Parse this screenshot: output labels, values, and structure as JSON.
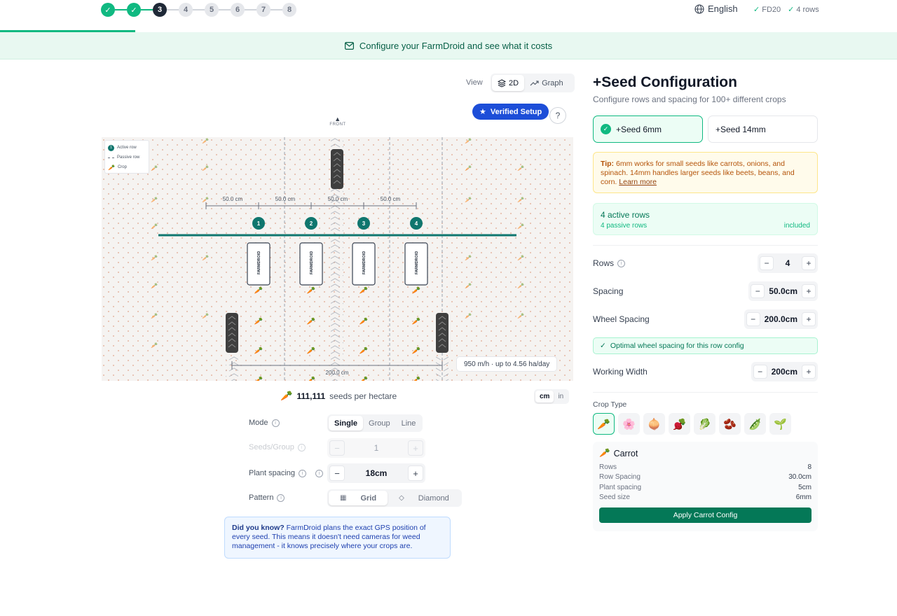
{
  "stepper": {
    "steps": [
      "1",
      "2",
      "3",
      "4",
      "5",
      "6",
      "7",
      "8"
    ],
    "completed": 2,
    "current": 3
  },
  "header": {
    "language": "English",
    "model_tags": [
      "FD20",
      "4 rows"
    ]
  },
  "banner": {
    "text": "Configure your FarmDroid and see what it costs"
  },
  "view": {
    "label": "View",
    "options": [
      "2D",
      "Graph"
    ],
    "selected": "2D"
  },
  "verified_label": "Verified Setup",
  "help_symbol": "?",
  "field": {
    "front_label": "FRONT",
    "legend": {
      "active_row": "Active row",
      "passive_row": "Passive row",
      "crop": "Crop",
      "marker": "1"
    },
    "row_spacing_labels": [
      "50.0 cm",
      "50.0 cm",
      "50.0 cm",
      "50.0 cm"
    ],
    "row_numbers": [
      "1",
      "2",
      "3",
      "4"
    ],
    "seeder_label": "FARMDROID",
    "wheel_spacing_label": "200.0 cm",
    "speed_text": "950 m/h · up to 4.56 ha/day"
  },
  "seeds": {
    "count": "111,111",
    "label": "seeds per hectare"
  },
  "units": {
    "options": [
      "cm",
      "in"
    ],
    "selected": "cm"
  },
  "controls": {
    "mode": {
      "label": "Mode",
      "options": [
        "Single",
        "Group",
        "Line"
      ],
      "selected": "Single"
    },
    "seeds_group": {
      "label": "Seeds/Group",
      "value": "1"
    },
    "plant_spacing": {
      "label": "Plant spacing",
      "value": "18cm"
    },
    "pattern": {
      "label": "Pattern",
      "options": [
        "Grid",
        "Diamond"
      ],
      "selected": "Grid"
    }
  },
  "did_you_know": {
    "lead": "Did you know?",
    "body": " FarmDroid plans the exact GPS position of every seed. This means it doesn't need cameras for weed management - it knows precisely where your crops are."
  },
  "config": {
    "title": "+Seed Configuration",
    "subtitle": "Configure rows and spacing for 100+ different crops",
    "seed_options": [
      "+Seed 6mm",
      "+Seed 14mm"
    ],
    "selected_seed": "+Seed 6mm",
    "tip_lead": "Tip:",
    "tip_body": " 6mm works for small seeds like carrots, onions, and spinach. 14mm handles larger seeds like beets, beans, and corn. ",
    "tip_link": "Learn more",
    "active_rows": "4 active rows",
    "passive_rows": "4 passive rows",
    "included": "included",
    "rows": {
      "label": "Rows",
      "value": "4"
    },
    "spacing": {
      "label": "Spacing",
      "value": "50.0cm"
    },
    "wheel_spacing": {
      "label": "Wheel Spacing",
      "value": "200.0cm"
    },
    "optimal_text": "Optimal wheel spacing for this row config",
    "working_width": {
      "label": "Working Width",
      "value": "200cm"
    },
    "crop_type_label": "Crop Type",
    "crops": [
      "🥕",
      "🌸",
      "🧅",
      "🫜",
      "🥬",
      "🫘",
      "🫛",
      "🌱"
    ],
    "selected_crop": {
      "icon": "🥕",
      "name": "Carrot",
      "rows_label": "Rows",
      "rows": "8",
      "row_spacing_label": "Row Spacing",
      "row_spacing": "30.0cm",
      "plant_spacing_label": "Plant spacing",
      "plant_spacing": "5cm",
      "seed_size_label": "Seed size",
      "seed_size": "6mm",
      "apply_label": "Apply Carrot Config"
    }
  },
  "colors": {
    "accent": "#10b981",
    "teal": "#0f766e",
    "verified": "#1d4ed8",
    "apply": "#047857"
  }
}
